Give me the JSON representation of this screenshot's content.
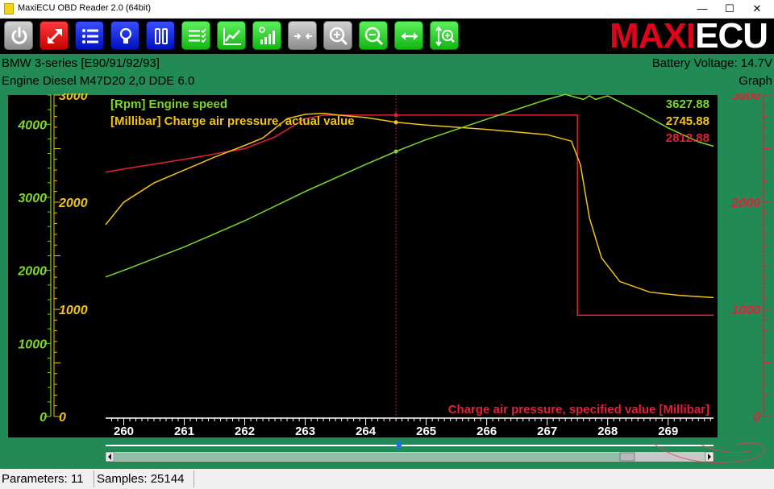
{
  "window": {
    "title": "MaxiECU OBD Reader 2.0 (64bit)",
    "minimize": "—",
    "maximize": "☐",
    "close": "✕"
  },
  "toolbar": {
    "buttons": [
      {
        "name": "power-button",
        "icon": "power-icon",
        "color": "gray"
      },
      {
        "name": "fullscreen-button",
        "icon": "expand-arrows-icon",
        "color": "red"
      },
      {
        "name": "parameter-list-button",
        "icon": "list-icon",
        "color": "blue"
      },
      {
        "name": "bulb-button",
        "icon": "bulb-icon",
        "color": "blue"
      },
      {
        "name": "tools-button",
        "icon": "tools-icon",
        "color": "blue"
      },
      {
        "name": "select-list-button",
        "icon": "checklist-icon",
        "color": "green"
      },
      {
        "name": "graph-button",
        "icon": "line-chart-icon",
        "color": "green"
      },
      {
        "name": "signal-button",
        "icon": "signal-bars-icon",
        "color": "green"
      },
      {
        "name": "collapse-button",
        "icon": "arrows-inward-icon",
        "color": "gray"
      },
      {
        "name": "zoom-in-button",
        "icon": "zoom-in-icon",
        "color": "gray"
      },
      {
        "name": "zoom-out-button",
        "icon": "zoom-out-icon",
        "color": "green"
      },
      {
        "name": "fit-width-button",
        "icon": "horizontal-arrows-icon",
        "color": "green"
      },
      {
        "name": "zoom-vertical-button",
        "icon": "vertical-zoom-icon",
        "color": "green"
      }
    ],
    "logo_left": "MAXI",
    "logo_right": "ECU"
  },
  "info": {
    "vehicle": "BMW 3-series [E90/91/92/93]",
    "engine": "Engine Diesel M47D20 2,0 DDE 6.0",
    "battery": "Battery Voltage: 14.7V",
    "mode": "Graph"
  },
  "colors": {
    "rpm": "#7fd62b",
    "actual": "#f0c418",
    "specified": "#e0213b",
    "background": "#000000",
    "panel": "#218a55"
  },
  "chart_data": {
    "type": "line",
    "x_label": "",
    "xlim": [
      259.7,
      269.75
    ],
    "x_ticks": [
      "260",
      "261",
      "262",
      "263",
      "264",
      "265",
      "266",
      "267",
      "268",
      "269"
    ],
    "cursor_x": 264.5,
    "series": [
      {
        "name": "[Rpm] Engine speed",
        "axis": "left",
        "color": "#7fd62b",
        "readout": "3627.88",
        "ylim": [
          0,
          4400
        ],
        "ticks": [
          "0",
          "1000",
          "2000",
          "3000",
          "4000"
        ],
        "x": [
          259.7,
          260.0,
          261.0,
          262.0,
          263.0,
          264.0,
          264.5,
          265.0,
          266.0,
          267.0,
          267.3,
          267.6,
          267.7,
          267.8,
          268.0,
          268.5,
          269.0,
          269.5,
          269.75
        ],
        "y": [
          1910,
          2000,
          2320,
          2680,
          3080,
          3450,
          3627.88,
          3790,
          4070,
          4340,
          4410,
          4340,
          4390,
          4340,
          4390,
          4180,
          3950,
          3760,
          3700
        ]
      },
      {
        "name": "[Millibar] Charge air pressure, actual value",
        "axis": "left-inner",
        "color": "#f0c418",
        "readout": "2745.88",
        "ylim": [
          0,
          3000
        ],
        "ticks": [
          "0",
          "1000",
          "2000",
          "3000"
        ],
        "x": [
          259.7,
          260.0,
          260.5,
          261.0,
          261.5,
          262.0,
          262.3,
          262.7,
          263.0,
          263.3,
          263.6,
          264.0,
          264.5,
          265.0,
          266.0,
          267.0,
          267.4,
          267.55,
          267.7,
          267.9,
          268.2,
          268.7,
          269.2,
          269.75
        ],
        "y": [
          1790,
          2000,
          2180,
          2300,
          2420,
          2530,
          2600,
          2780,
          2820,
          2830,
          2810,
          2790,
          2745.88,
          2720,
          2680,
          2630,
          2570,
          2350,
          1850,
          1480,
          1260,
          1160,
          1130,
          1110
        ]
      },
      {
        "name": "Charge air pressure, specified value [Millibar]",
        "axis": "right",
        "color": "#e0213b",
        "readout": "2812.88",
        "ylim": [
          0,
          3000
        ],
        "ticks": [
          "0",
          "1000",
          "2000",
          "3000"
        ],
        "x": [
          259.7,
          260.0,
          261.0,
          262.0,
          262.5,
          263.0,
          263.3,
          263.6,
          264.5,
          265.0,
          266.0,
          267.0,
          267.5,
          267.5,
          269.75
        ],
        "y": [
          2280,
          2310,
          2400,
          2500,
          2610,
          2780,
          2812,
          2812.88,
          2812.88,
          2812.88,
          2812.88,
          2812.88,
          2812.88,
          945,
          945
        ]
      }
    ]
  },
  "status": {
    "parameters": "Parameters: 11",
    "samples": "Samples: 25144"
  }
}
